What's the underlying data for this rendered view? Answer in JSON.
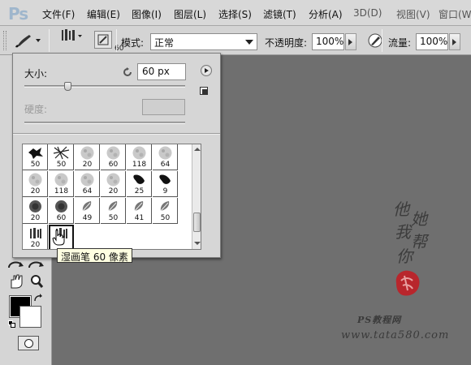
{
  "app": {
    "logo": "Ps",
    "menu": [
      "文件(F)",
      "编辑(E)",
      "图像(I)",
      "图层(L)",
      "选择(S)",
      "滤镜(T)",
      "分析(A)",
      "3D(D)",
      "视图(V)",
      "窗口(W)"
    ]
  },
  "options": {
    "brush_size": "60",
    "mode_label": "模式:",
    "mode_value": "正常",
    "opacity_label": "不透明度:",
    "opacity_value": "100%",
    "flow_label": "流量:",
    "flow_value": "100%"
  },
  "picker": {
    "size_label": "大小:",
    "size_value": "60 px",
    "size_slider_fraction": 0.27,
    "hardness_label": "硬度:",
    "hardness_value": "",
    "brushes": [
      {
        "size": "50",
        "icon": "scatter-black-brush"
      },
      {
        "size": "50",
        "icon": "hatch-brush"
      },
      {
        "size": "20",
        "icon": "soft-texture-brush"
      },
      {
        "size": "60",
        "icon": "soft-texture-brush"
      },
      {
        "size": "118",
        "icon": "soft-texture-brush"
      },
      {
        "size": "64",
        "icon": "soft-texture-brush"
      },
      {
        "size": "20",
        "icon": "soft-texture-brush"
      },
      {
        "size": "118",
        "icon": "soft-texture-brush"
      },
      {
        "size": "64",
        "icon": "soft-texture-brush"
      },
      {
        "size": "20",
        "icon": "soft-texture-brush"
      },
      {
        "size": "25",
        "icon": "dark-splash-brush"
      },
      {
        "size": "9",
        "icon": "dark-splash-brush"
      },
      {
        "size": "20",
        "icon": "dark-round-brush"
      },
      {
        "size": "60",
        "icon": "dark-round-brush"
      },
      {
        "size": "49",
        "icon": "leaf-brush"
      },
      {
        "size": "50",
        "icon": "leaf-brush"
      },
      {
        "size": "41",
        "icon": "leaf-brush"
      },
      {
        "size": "50",
        "icon": "leaf-brush"
      },
      {
        "size": "20",
        "icon": "wet-brush"
      },
      {
        "size": "",
        "icon": "wet-brush",
        "selected": true
      }
    ],
    "tooltip": "湿画笔 60 像素"
  },
  "watermark": {
    "vertical": [
      "他",
      "她",
      "我",
      "帮",
      "你"
    ],
    "line1": "PS教程网",
    "line2": "www.tata580.com"
  },
  "colors": {
    "menubar_bg": "#d8d8d8",
    "workspace_bg": "#6f6f6f",
    "foreground": "#000000",
    "background": "#ffffff",
    "tooltip_bg": "#ffffe1"
  }
}
